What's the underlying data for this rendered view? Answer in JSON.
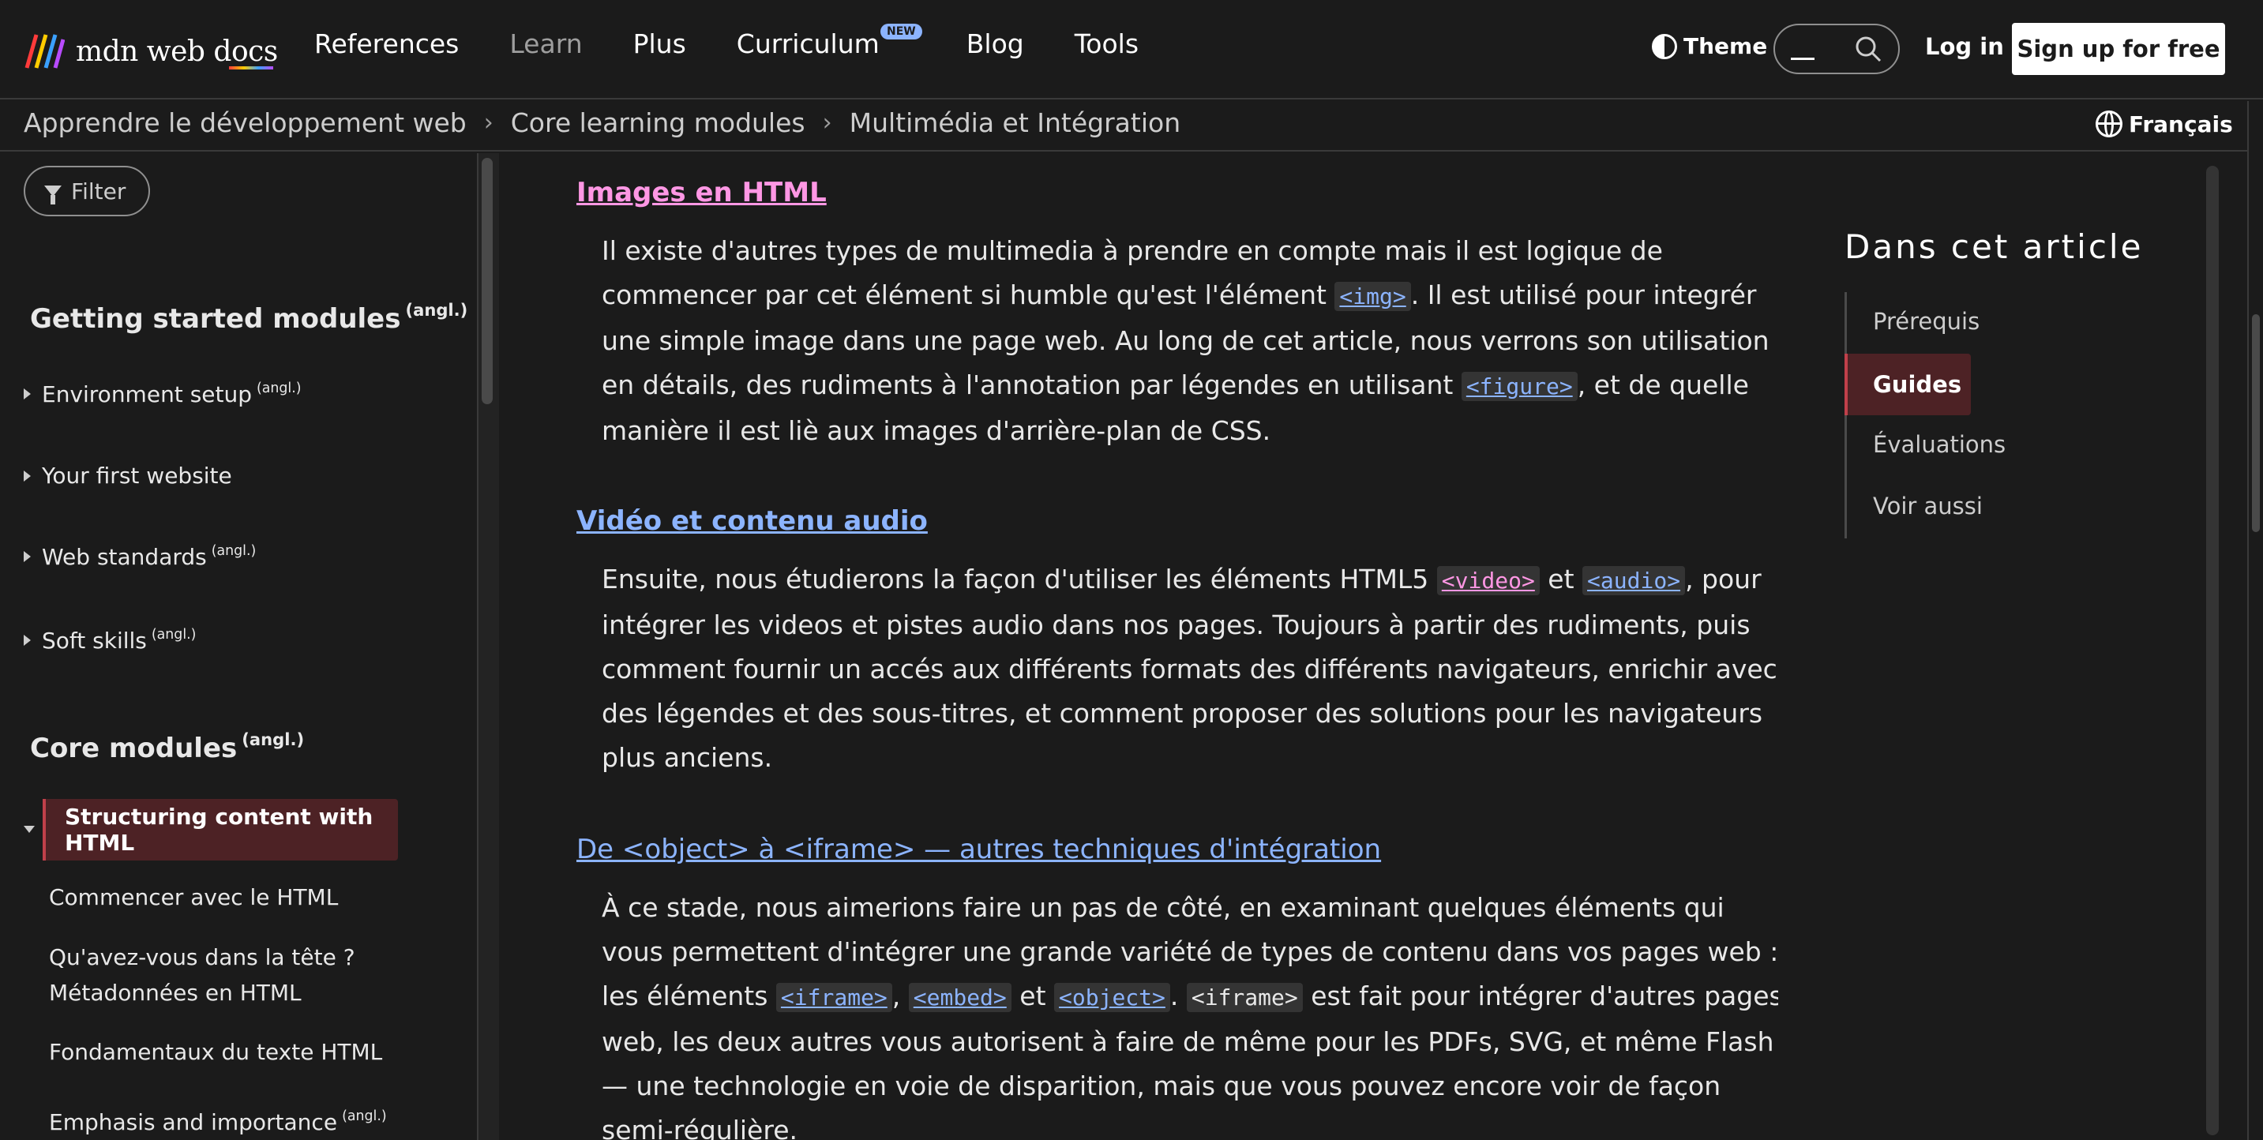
{
  "brand": {
    "name": "mdn web docs"
  },
  "nav": {
    "references": "References",
    "learn": "Learn",
    "plus": "Plus",
    "curriculum": "Curriculum",
    "curriculum_badge": "NEW",
    "blog": "Blog",
    "tools": "Tools",
    "theme": "Theme",
    "login": "Log in",
    "signup": "Sign up for free"
  },
  "breadcrumb": {
    "items": [
      "Apprendre le développement web",
      "Core learning modules",
      "Multimédia et Intégration"
    ],
    "separator": "›",
    "language": "Français"
  },
  "sidebar": {
    "filter": "Filter",
    "sections": [
      {
        "title": "Getting started modules",
        "tag": "(angl.)"
      },
      {
        "title": "Core modules",
        "tag": "(angl.)"
      }
    ],
    "items": [
      {
        "label": "Environment setup",
        "tag": "(angl.)"
      },
      {
        "label": "Your first website",
        "tag": ""
      },
      {
        "label": "Web standards",
        "tag": "(angl.)"
      },
      {
        "label": "Soft skills",
        "tag": "(angl.)"
      }
    ],
    "active": "Structuring content with HTML",
    "subitems": [
      {
        "label": "Commencer avec le HTML",
        "tag": ""
      },
      {
        "label": "Qu'avez-vous dans la tête ? Métadonnées en HTML",
        "tag": ""
      },
      {
        "label": "Fondamentaux du texte HTML",
        "tag": ""
      },
      {
        "label": "Emphasis and importance",
        "tag": "(angl.)"
      }
    ]
  },
  "content": {
    "s1": {
      "title": "Images en HTML",
      "p_a": "Il existe d'autres types de multimedia à prendre en compte mais il est logique de commencer par cet élément si humble qu'est l'élément ",
      "code1": "<img>",
      "p_b": ". Il est utilisé pour integrér une simple image dans une page web. Au long de cet article, nous verrons son utilisation en détails, des rudiments à l'annotation par légendes en utilisant ",
      "code2": "<figure>",
      "p_c": ", et de quelle manière il est liè aux images d'arrière-plan de CSS."
    },
    "s2": {
      "title": "Vidéo et contenu audio",
      "p_a": "Ensuite, nous étudierons la façon d'utiliser les éléments HTML5 ",
      "code1": "<video>",
      "p_b": " et ",
      "code2": "<audio>",
      "p_c": ", pour intégrer les videos et pistes audio dans nos pages. Toujours à partir des rudiments, puis comment fournir un accés aux différents formats des différents navigateurs, enrichir avec des légendes et des sous-titres, et comment proposer des solutions pour les navigateurs plus anciens."
    },
    "s3": {
      "title": "De <object> à <iframe> — autres techniques d'intégration",
      "p_a": "À ce stade, nous aimerions faire un pas de côté, en examinant quelques éléments qui vous permettent d'intégrer une grande variété de types de contenu dans vos pages web : les éléments ",
      "code1": "<iframe>",
      "sep1": ", ",
      "code2": "<embed>",
      "sep2": " et ",
      "code3": "<object>",
      "sep3": ". ",
      "code4": "<iframe>",
      "p_b": " est fait pour intégrer d'autres pages web, les deux autres vous autorisent à faire de même pour les PDFs, SVG, et même Flash — une technologie en voie de disparition, mais que vous pouvez encore voir de façon semi-régulière."
    }
  },
  "toc": {
    "title": "Dans cet article",
    "items": [
      "Prérequis",
      "Guides",
      "Évaluations",
      "Voir aussi"
    ],
    "active_index": 1
  },
  "colors": {
    "background": "#1b1b1b",
    "link_blue": "#8cb4ff",
    "link_pink": "#ff97e4",
    "active_bg": "#4d2225",
    "active_border": "#c0404a"
  }
}
